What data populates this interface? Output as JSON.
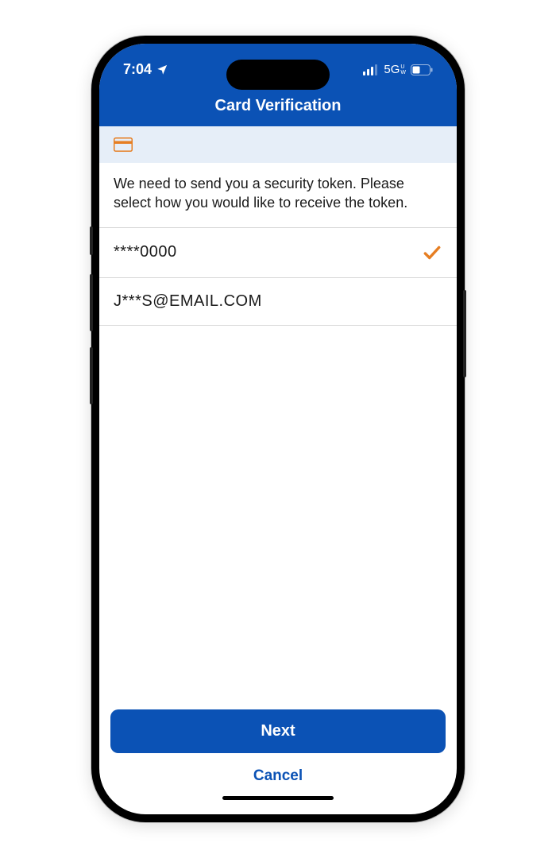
{
  "status": {
    "time": "7:04",
    "network_label": "5G",
    "network_sub": "U\nW"
  },
  "header": {
    "title": "Card Verification"
  },
  "strip": {
    "icon_name": "credit-card-icon"
  },
  "instruction": {
    "text": "We need to send you a security token. Please select how you would like to receive the token."
  },
  "options": [
    {
      "label": "****0000",
      "selected": true
    },
    {
      "label": "J***S@EMAIL.COM",
      "selected": false
    }
  ],
  "buttons": {
    "primary": "Next",
    "secondary": "Cancel"
  },
  "colors": {
    "accent": "#0b52b5",
    "check": "#e67e22"
  }
}
